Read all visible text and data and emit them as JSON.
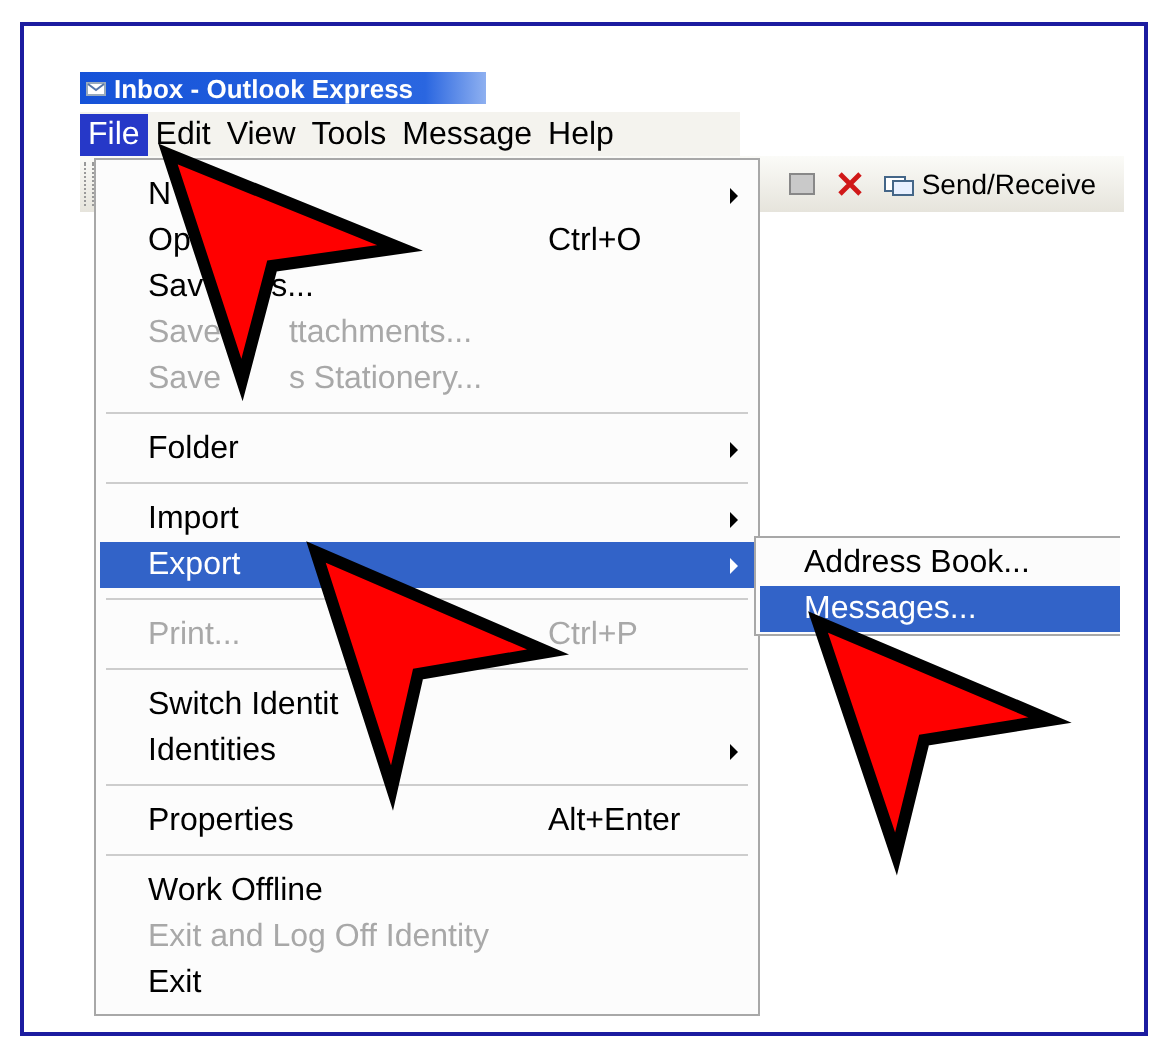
{
  "window": {
    "title": "Inbox - Outlook Express"
  },
  "menu_bar": [
    {
      "label": "File",
      "selected": true
    },
    {
      "label": "Edit",
      "selected": false
    },
    {
      "label": "View",
      "selected": false
    },
    {
      "label": "Tools",
      "selected": false
    },
    {
      "label": "Message",
      "selected": false
    },
    {
      "label": "Help",
      "selected": false
    }
  ],
  "toolbar": {
    "send_receive_label": "Send/Receive"
  },
  "file_menu": [
    {
      "kind": "item",
      "parts": [
        "N"
      ],
      "has_submenu": true,
      "disabled": false,
      "selected": false
    },
    {
      "kind": "item",
      "parts": [
        "Op"
      ],
      "shortcut": "Ctrl+O",
      "has_submenu": false,
      "disabled": false,
      "selected": false
    },
    {
      "kind": "item",
      "parts": [
        "Sav",
        "s..."
      ],
      "has_submenu": false,
      "disabled": false,
      "selected": false
    },
    {
      "kind": "item",
      "parts": [
        "Save",
        "ttachments..."
      ],
      "has_submenu": false,
      "disabled": true,
      "selected": false
    },
    {
      "kind": "item",
      "parts": [
        "Save",
        "s Stationery..."
      ],
      "has_submenu": false,
      "disabled": true,
      "selected": false
    },
    {
      "kind": "separator"
    },
    {
      "kind": "item",
      "parts": [
        "Folder"
      ],
      "has_submenu": true,
      "disabled": false,
      "selected": false
    },
    {
      "kind": "separator"
    },
    {
      "kind": "item",
      "parts": [
        "Import"
      ],
      "has_submenu": true,
      "disabled": false,
      "selected": false
    },
    {
      "kind": "item",
      "parts": [
        "Export"
      ],
      "has_submenu": true,
      "disabled": false,
      "selected": true
    },
    {
      "kind": "separator"
    },
    {
      "kind": "item",
      "parts": [
        "Print..."
      ],
      "shortcut": "Ctrl+P",
      "has_submenu": false,
      "disabled": true,
      "selected": false
    },
    {
      "kind": "separator"
    },
    {
      "kind": "item",
      "parts": [
        "Switch Identit"
      ],
      "has_submenu": false,
      "disabled": false,
      "selected": false
    },
    {
      "kind": "item",
      "parts": [
        "Identities"
      ],
      "has_submenu": true,
      "disabled": false,
      "selected": false
    },
    {
      "kind": "separator"
    },
    {
      "kind": "item",
      "parts": [
        "Properties"
      ],
      "shortcut": "Alt+Enter",
      "has_submenu": false,
      "disabled": false,
      "selected": false
    },
    {
      "kind": "separator"
    },
    {
      "kind": "item",
      "parts": [
        "Work Offline"
      ],
      "has_submenu": false,
      "disabled": false,
      "selected": false
    },
    {
      "kind": "item",
      "parts": [
        "Exit and Log Off Identity"
      ],
      "has_submenu": false,
      "disabled": true,
      "selected": false
    },
    {
      "kind": "item",
      "parts": [
        "Exit"
      ],
      "has_submenu": false,
      "disabled": false,
      "selected": false
    }
  ],
  "export_submenu": [
    {
      "label": "Address Book...",
      "selected": false
    },
    {
      "label": "Messages...",
      "selected": true
    }
  ]
}
